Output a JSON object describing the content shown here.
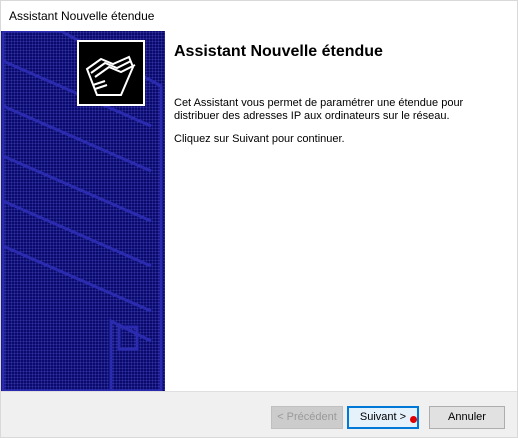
{
  "window": {
    "title": "Assistant Nouvelle étendue"
  },
  "banner": {
    "icon": "folders-icon",
    "background_color": "#0a0a6e"
  },
  "content": {
    "heading": "Assistant Nouvelle étendue",
    "description": "Cet Assistant vous permet de paramétrer une étendue pour distribuer des adresses IP aux ordinateurs sur le réseau.",
    "continue_text": "Cliquez sur Suivant pour continuer."
  },
  "buttons": {
    "previous_label": "< Précédent",
    "next_label": "Suivant >",
    "cancel_label": "Annuler"
  },
  "colors": {
    "accent": "#0078d7",
    "pointer_dot": "#e00000"
  }
}
